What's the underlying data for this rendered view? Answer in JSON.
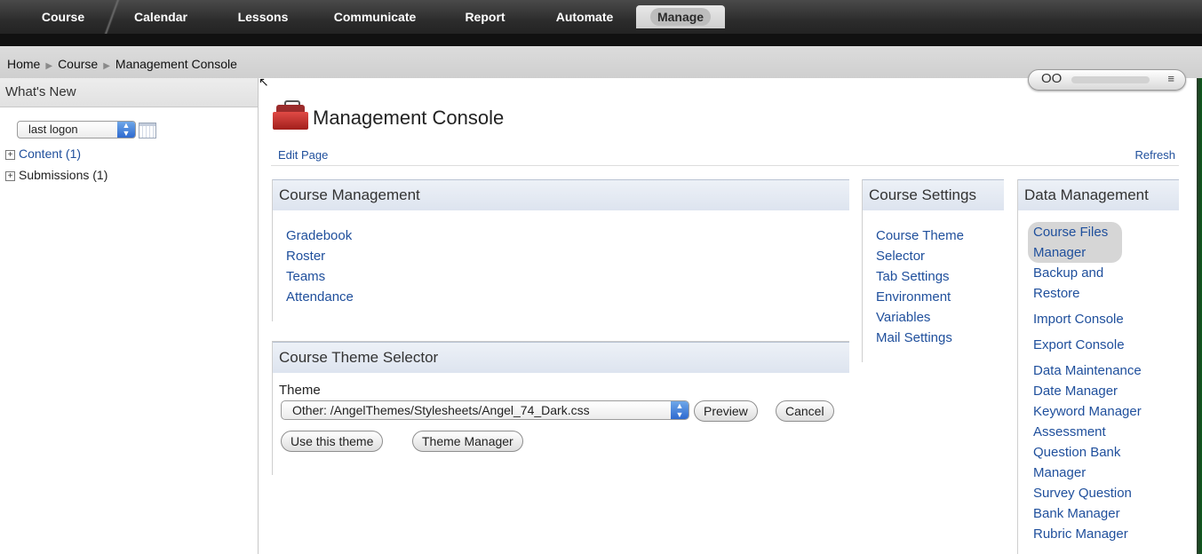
{
  "topnav": {
    "tabs": [
      {
        "label": "Course"
      },
      {
        "label": "Calendar"
      },
      {
        "label": "Lessons"
      },
      {
        "label": "Communicate"
      },
      {
        "label": "Report"
      },
      {
        "label": "Automate"
      },
      {
        "label": "Manage",
        "active": true
      }
    ]
  },
  "breadcrumb": {
    "items": [
      "Home",
      "Course",
      "Management Console"
    ]
  },
  "user_menu": {
    "icon": "glasses-icon"
  },
  "whats_new": {
    "title": "What's New",
    "filter_value": "last logon",
    "items": [
      {
        "label": "Content (1)"
      },
      {
        "label": "Submissions (1)"
      }
    ]
  },
  "page": {
    "title": "Management Console",
    "edit_link": "Edit Page",
    "refresh_link": "Refresh"
  },
  "course_management": {
    "title": "Course Management",
    "links": [
      "Gradebook",
      "Roster",
      "Teams",
      "Attendance"
    ]
  },
  "course_theme_selector": {
    "title": "Course Theme Selector",
    "theme_label": "Theme",
    "theme_value": "Other: /AngelThemes/Stylesheets/Angel_74_Dark.css",
    "buttons": {
      "preview": "Preview",
      "cancel": "Cancel",
      "use_theme": "Use this theme",
      "theme_manager": "Theme Manager"
    }
  },
  "course_settings": {
    "title": "Course Settings",
    "links": [
      "Course Theme",
      "Selector",
      "Tab Settings",
      "Environment",
      "Variables",
      "Mail Settings"
    ]
  },
  "data_management": {
    "title": "Data Management",
    "links": [
      "Course Files",
      "Manager",
      "Backup and",
      "Restore",
      "Import Console",
      "Export Console",
      "Data Maintenance",
      "Date Manager",
      "Keyword Manager",
      "Assessment",
      "Question Bank",
      "Manager",
      "Survey Question",
      "Bank Manager",
      "Rubric Manager"
    ]
  },
  "colors": {
    "link": "#1f4f9c",
    "nav_bg": "#2c2c2c",
    "portlet_header": "#dde4ef"
  }
}
